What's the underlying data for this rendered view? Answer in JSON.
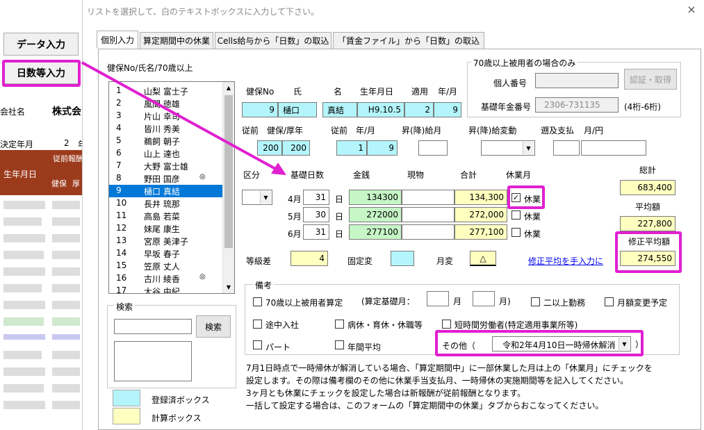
{
  "excel": {
    "data_input_label": "データ入力",
    "days_input_label": "日数等入力",
    "company_label": "会社名",
    "company_value": "株式会",
    "decision_year_label": "決定年月",
    "decision_num": "2",
    "decision_num2": "年",
    "header_birthday": "生年月日",
    "header_before": "従前報酬",
    "header_kenpo": "健保",
    "header_kou": "厚"
  },
  "dialog": {
    "title": "リストを選択して、白のテキストボックスに入力して下さい。",
    "close": "×",
    "tabs": [
      {
        "label": "個別入力"
      },
      {
        "label": "算定期間中の休業"
      },
      {
        "label": "Cells給与から「日数」の取込"
      },
      {
        "label": "「賃金ファイル」から「日数」の取込"
      }
    ]
  },
  "list": {
    "header": "健保No/氏名/70歳以上",
    "rows": [
      {
        "no": "1",
        "name": "山梨 富士子",
        "mark": ""
      },
      {
        "no": "2",
        "name": "風間 徳雄",
        "mark": ""
      },
      {
        "no": "3",
        "name": "片山 幸司",
        "mark": ""
      },
      {
        "no": "4",
        "name": "皆川 秀美",
        "mark": ""
      },
      {
        "no": "5",
        "name": "鵜飼 朝子",
        "mark": ""
      },
      {
        "no": "6",
        "name": "山上 達也",
        "mark": ""
      },
      {
        "no": "7",
        "name": "大野 富士雄",
        "mark": ""
      },
      {
        "no": "8",
        "name": "野田 国彦",
        "mark": "◎"
      },
      {
        "no": "9",
        "name": "樋口 真結",
        "mark": ""
      },
      {
        "no": "10",
        "name": "長井 琉那",
        "mark": ""
      },
      {
        "no": "11",
        "name": "高島 若菜",
        "mark": ""
      },
      {
        "no": "12",
        "name": "妹尾 康生",
        "mark": ""
      },
      {
        "no": "13",
        "name": "宮原 美津子",
        "mark": ""
      },
      {
        "no": "14",
        "name": "早坂 春子",
        "mark": ""
      },
      {
        "no": "15",
        "name": "笠原 丈人",
        "mark": ""
      },
      {
        "no": "16",
        "name": "古川 綾香",
        "mark": "◎"
      },
      {
        "no": "17",
        "name": "大谷 由紀",
        "mark": ""
      }
    ],
    "selected_index": 8
  },
  "search": {
    "group_label": "検索",
    "button": "検索",
    "input_value": ""
  },
  "legend": {
    "registered": "登録済ボックス",
    "calc": "計算ボックス"
  },
  "over70": {
    "group_label": "70歳以上被用者の場合のみ",
    "personal_no_label": "個人番号",
    "pension_no_label": "基礎年金番号",
    "pension_no_value": "2306-731135",
    "digits_note": "(4桁-6桁)",
    "auth_button": "認証・取得"
  },
  "info": {
    "headers": {
      "kenpo_no": "健保No",
      "sei": "氏",
      "mei": "名",
      "birthday": "生年月日",
      "apply": "適用",
      "ym": "年/月"
    },
    "values": {
      "kenpo_no": "9",
      "sei": "樋口",
      "mei": "真結",
      "birthday": "H9.10.5",
      "apply_y": "2",
      "apply_m": "9"
    }
  },
  "prev": {
    "label_before": "従前",
    "label_kenpo_kou": "健保/厚年",
    "label_before2": "従前",
    "label_ym": "年/月",
    "label_raise": "昇(降)給月",
    "label_raise_change": "昇(降)給変動",
    "label_retro": "遡及支払",
    "label_month_yen": "月/円",
    "kenpo": "200",
    "kounen": "200",
    "year": "1",
    "month": "9"
  },
  "salary": {
    "label_kubun": "区分",
    "label_days": "基礎日数",
    "label_money": "金銭",
    "label_goods": "現物",
    "label_total": "合計",
    "label_leave": "休業月",
    "label_sum": "総計",
    "label_avg": "平均額",
    "label_adj_avg": "修正平均額",
    "day_unit": "日",
    "leave_label": "休業",
    "rows": [
      {
        "month": "4月",
        "days": "31",
        "money": "134300",
        "goods": "",
        "total": "134,300",
        "leave": true
      },
      {
        "month": "5月",
        "days": "30",
        "money": "272000",
        "goods": "",
        "total": "272,000",
        "leave": false
      },
      {
        "month": "6月",
        "days": "31",
        "money": "277100",
        "goods": "",
        "total": "277,100",
        "leave": false
      }
    ],
    "sum": "683,400",
    "avg": "227,800",
    "adj_avg": "274,550",
    "grade_diff_label": "等級差",
    "grade_diff": "4",
    "fixed_change_label": "固定変",
    "month_change_label": "月変",
    "month_change": "△",
    "manual_link": "修正平均を手入力に"
  },
  "remarks": {
    "group_label": "備考",
    "over70_calc": "70歳以上被用者算定",
    "calc_base_label": "(算定基礎月：",
    "month1": "月",
    "month2": "月)",
    "multi_work": "二以上勤務",
    "monthly_change": "月額変更予定",
    "mid_join": "途中入社",
    "sick_leave": "病休・育休・休職等",
    "short_time": "短時間労働者(特定適用事業所等)",
    "part": "パート",
    "annual_avg": "年間平均",
    "other_label": "その他（",
    "other_value": "令和2年4月10日一時帰休解消",
    "other_close": "）"
  },
  "notes": [
    "7月1日時点で一時帰休が解消している場合、「算定期間中」に一部休業した月は上の「休業月」にチェックを",
    "設定します。その際は備考欄のその他に休業手当支払月、一時帰休の実施期間等を記入してください。",
    "3ヶ月とも休業にチェックを設定した場合は新報酬が従前報酬となります。",
    "一括して設定する場合は、このフォームの「算定期間中の休業」タブからおこなってください。"
  ],
  "colors": {
    "highlight": "#e020d0",
    "cyan": "#b3f5fb",
    "yellow": "#ffffc0",
    "green": "#c6f5c6",
    "select": "#0078d7"
  }
}
